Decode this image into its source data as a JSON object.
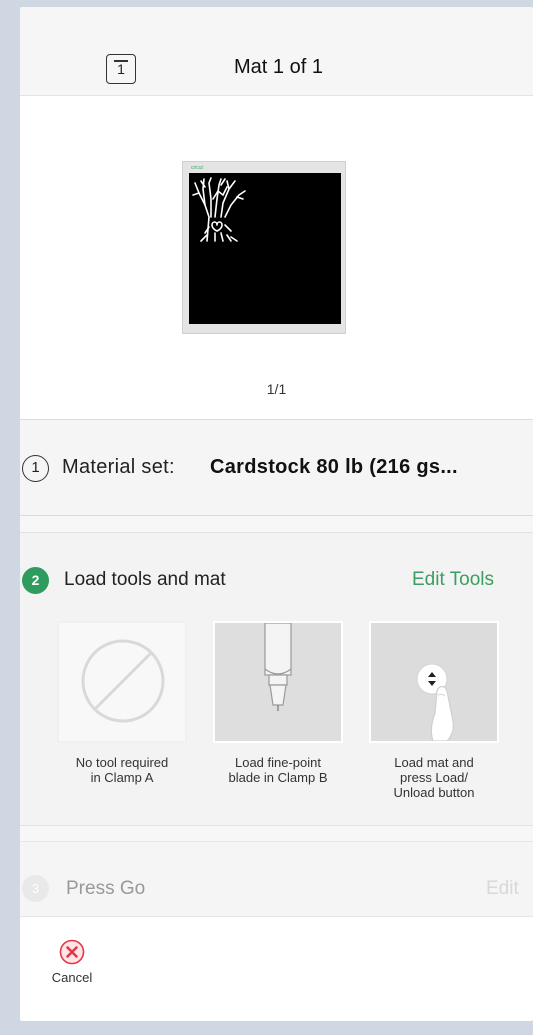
{
  "header": {
    "mat_icon_number": "1",
    "title": "Mat 1 of 1"
  },
  "preview": {
    "mat_brand": "cricut",
    "page_count": "1/1"
  },
  "material": {
    "step_number": "1",
    "label": "Material set:",
    "value": "Cardstock 80 lb (216 gs..."
  },
  "load": {
    "step_number": "2",
    "title": "Load tools and mat",
    "edit_tools_label": "Edit Tools",
    "cards": [
      {
        "caption_line1": "No tool required",
        "caption_line2": "in Clamp A",
        "caption_line3": ""
      },
      {
        "caption_line1": "Load fine-point",
        "caption_line2": "blade in Clamp B",
        "caption_line3": ""
      },
      {
        "caption_line1": "Load mat and",
        "caption_line2": "press Load/",
        "caption_line3": "Unload button"
      }
    ]
  },
  "press_go": {
    "step_number": "3",
    "label": "Press Go",
    "edit_label": "Edit"
  },
  "footer": {
    "cancel_label": "Cancel"
  },
  "colors": {
    "accent_green": "#2e9b5f",
    "link_green": "#3c9d63",
    "cancel_red": "#e0394a",
    "page_background": "#cfd8e2"
  }
}
